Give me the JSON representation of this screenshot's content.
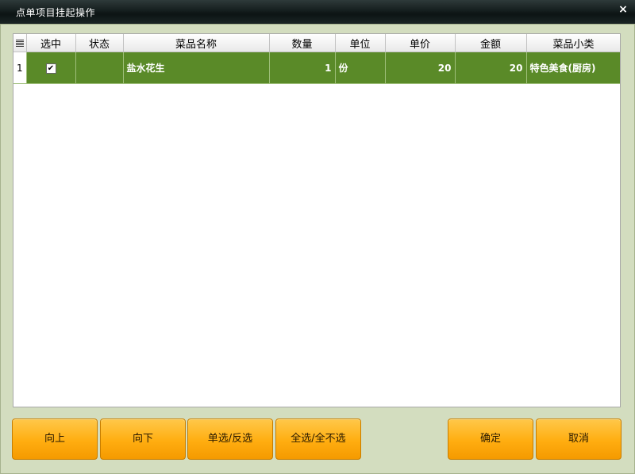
{
  "window": {
    "title": "点单项目挂起操作",
    "close_symbol": "×"
  },
  "table": {
    "columns": [
      "选中",
      "状态",
      "菜品名称",
      "数量",
      "单位",
      "单价",
      "金额",
      "菜品小类"
    ],
    "rows": [
      {
        "index": "1",
        "selected": true,
        "status": "",
        "dish_name": "盐水花生",
        "quantity": "1",
        "unit": "份",
        "unit_price": "20",
        "amount": "20",
        "category": "特色美食(厨房)"
      }
    ]
  },
  "buttons": {
    "up": "向上",
    "down": "向下",
    "toggle_select": "单选/反选",
    "select_all": "全选/全不选",
    "ok": "确定",
    "cancel": "取消"
  },
  "colors": {
    "row_selected": "#5a8a28",
    "button": "#ffad10",
    "titlebar": "#0c1414"
  }
}
